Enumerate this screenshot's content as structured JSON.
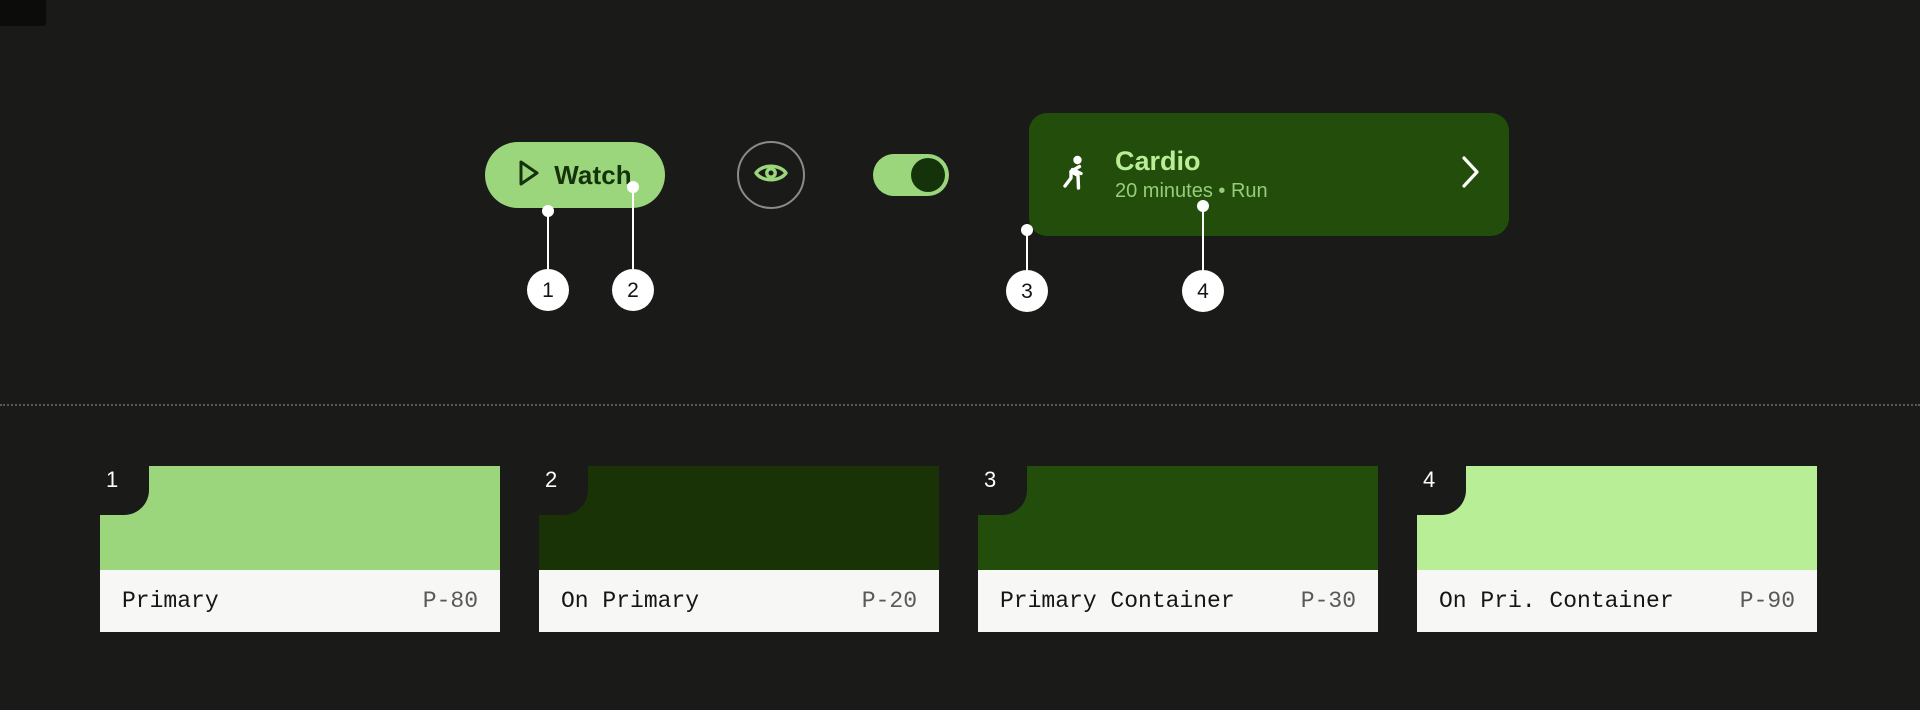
{
  "theme": {
    "background": "#1A1A18",
    "divider_color": "#5A5A55",
    "callout_bubble_bg": "#FFFFFF",
    "callout_bubble_text": "#141414",
    "label_bar_bg": "#F7F7F5"
  },
  "components": {
    "watch_button": {
      "label": "Watch",
      "icon": "play-icon",
      "background": "#9BD67D",
      "text_color": "#14330A"
    },
    "eye_button": {
      "icon": "eye-icon",
      "icon_color": "#9BD67D",
      "border_color": "#8C8C87"
    },
    "toggle": {
      "state": "on",
      "track_color": "#9BD67D",
      "thumb_color": "#14330A"
    },
    "cardio_card": {
      "icon": "running-person-icon",
      "title": "Cardio",
      "subtitle": "20 minutes • Run",
      "trailing_icon": "chevron-right-icon",
      "background": "#234D0B",
      "title_color": "#B8EE96",
      "subtitle_color": "#95CE78"
    }
  },
  "callouts": [
    {
      "number": "1",
      "target": "watch-button-background"
    },
    {
      "number": "2",
      "target": "watch-button-label"
    },
    {
      "number": "3",
      "target": "cardio-card-background"
    },
    {
      "number": "4",
      "target": "cardio-card-subtitle"
    }
  ],
  "swatches": [
    {
      "number": "1",
      "name": "Primary",
      "token": "P-80",
      "color": "#9BD67D"
    },
    {
      "number": "2",
      "name": "On Primary",
      "token": "P-20",
      "color": "#1A3306"
    },
    {
      "number": "3",
      "name": "Primary Container",
      "token": "P-30",
      "color": "#234D0B"
    },
    {
      "number": "4",
      "name": "On Pri. Container",
      "token": "P-90",
      "color": "#B8EE96"
    }
  ]
}
